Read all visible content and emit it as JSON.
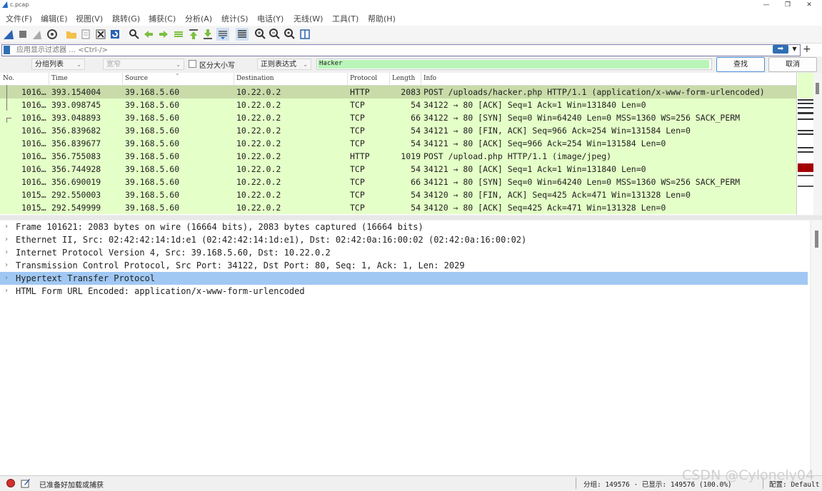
{
  "window": {
    "title": "c.pcap"
  },
  "menu": [
    "文件(F)",
    "编辑(E)",
    "视图(V)",
    "跳转(G)",
    "捕获(C)",
    "分析(A)",
    "统计(S)",
    "电话(Y)",
    "无线(W)",
    "工具(T)",
    "帮助(H)"
  ],
  "filter": {
    "placeholder": "应用显示过滤器 … <Ctrl-/>",
    "apply_icon": "arrow-right-icon",
    "add": "+"
  },
  "find": {
    "scope": "分组列表",
    "charset": "宽窄",
    "case_label": "区分大小写",
    "mode": "正则表达式",
    "value": "Hacker",
    "find_label": "查找",
    "cancel_label": "取消"
  },
  "packet_list": {
    "columns": [
      "No.",
      "Time",
      "Source",
      "Destination",
      "Protocol",
      "Length",
      "Info"
    ],
    "rows": [
      {
        "no": "1016…",
        "time": "393.154004",
        "src": "39.168.5.60",
        "dst": "10.22.0.2",
        "proto": "HTTP",
        "len": "2083",
        "info": "POST /uploads/hacker.php HTTP/1.1  (application/x-www-form-urlencoded)",
        "selected": true
      },
      {
        "no": "1016…",
        "time": "393.098745",
        "src": "39.168.5.60",
        "dst": "10.22.0.2",
        "proto": "TCP",
        "len": "54",
        "info": "34122 → 80 [ACK] Seq=1 Ack=1 Win=131840 Len=0"
      },
      {
        "no": "1016…",
        "time": "393.048893",
        "src": "39.168.5.60",
        "dst": "10.22.0.2",
        "proto": "TCP",
        "len": "66",
        "info": "34122 → 80 [SYN] Seq=0 Win=64240 Len=0 MSS=1360 WS=256 SACK_PERM"
      },
      {
        "no": "1016…",
        "time": "356.839682",
        "src": "39.168.5.60",
        "dst": "10.22.0.2",
        "proto": "TCP",
        "len": "54",
        "info": "34121 → 80 [FIN, ACK] Seq=966 Ack=254 Win=131584 Len=0"
      },
      {
        "no": "1016…",
        "time": "356.839677",
        "src": "39.168.5.60",
        "dst": "10.22.0.2",
        "proto": "TCP",
        "len": "54",
        "info": "34121 → 80 [ACK] Seq=966 Ack=254 Win=131584 Len=0"
      },
      {
        "no": "1016…",
        "time": "356.755083",
        "src": "39.168.5.60",
        "dst": "10.22.0.2",
        "proto": "HTTP",
        "len": "1019",
        "info": "POST /upload.php HTTP/1.1  (image/jpeg)"
      },
      {
        "no": "1016…",
        "time": "356.744928",
        "src": "39.168.5.60",
        "dst": "10.22.0.2",
        "proto": "TCP",
        "len": "54",
        "info": "34121 → 80 [ACK] Seq=1 Ack=1 Win=131840 Len=0"
      },
      {
        "no": "1016…",
        "time": "356.690019",
        "src": "39.168.5.60",
        "dst": "10.22.0.2",
        "proto": "TCP",
        "len": "66",
        "info": "34121 → 80 [SYN] Seq=0 Win=64240 Len=0 MSS=1360 WS=256 SACK_PERM"
      },
      {
        "no": "1015…",
        "time": "292.550003",
        "src": "39.168.5.60",
        "dst": "10.22.0.2",
        "proto": "TCP",
        "len": "54",
        "info": "34120 → 80 [FIN, ACK] Seq=425 Ack=471 Win=131328 Len=0"
      },
      {
        "no": "1015…",
        "time": "292.549999",
        "src": "39.168.5.60",
        "dst": "10.22.0.2",
        "proto": "TCP",
        "len": "54",
        "info": "34120 → 80 [ACK] Seq=425 Ack=471 Win=131328 Len=0"
      }
    ]
  },
  "details": [
    {
      "text": "Frame 101621: 2083 bytes on wire (16664 bits), 2083 bytes captured (16664 bits)"
    },
    {
      "text": "Ethernet II, Src: 02:42:42:14:1d:e1 (02:42:42:14:1d:e1), Dst: 02:42:0a:16:00:02 (02:42:0a:16:00:02)"
    },
    {
      "text": "Internet Protocol Version 4, Src: 39.168.5.60, Dst: 10.22.0.2"
    },
    {
      "text": "Transmission Control Protocol, Src Port: 34122, Dst Port: 80, Seq: 1, Ack: 1, Len: 2029"
    },
    {
      "text": "Hypertext Transfer Protocol",
      "selected": true
    },
    {
      "text": "HTML Form URL Encoded: application/x-www-form-urlencoded"
    }
  ],
  "status": {
    "ready": "已准备好加载或捕获",
    "packets": "分组: 149576 · 已显示: 149576 (100.0%)",
    "profile": "配置: Default"
  },
  "watermark": "CSDN @Cylonely04",
  "colors": {
    "row_bg": "#e4ffc7",
    "row_selected": "#c8dba8",
    "detail_selected": "#a0c8f3",
    "search_bg": "#b9f5b9"
  }
}
